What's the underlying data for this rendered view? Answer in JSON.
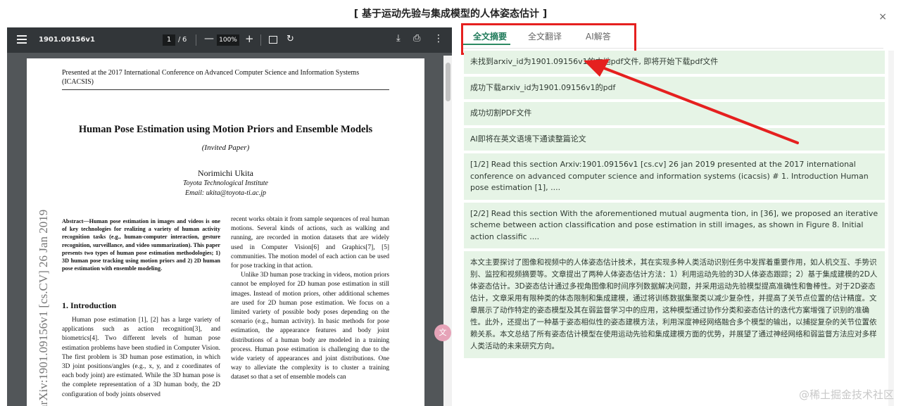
{
  "modal": {
    "title": "[ 基于运动先验与集成模型的人体姿态估计 ]",
    "close_icon": "×"
  },
  "pdf": {
    "toolbar": {
      "filename": "1901.09156v1",
      "page": "1",
      "slash": "/",
      "total": "6",
      "zoom": "100%",
      "minus": "—",
      "plus": "+",
      "rotate": "↻",
      "download": "⤓",
      "print": "⎙",
      "more": "⋮"
    },
    "page": {
      "header": "Presented at the 2017 International Conference on Advanced Computer Science and Information Systems (ICACSIS)",
      "title": "Human Pose Estimation using Motion Priors and Ensemble Models",
      "invited": "(Invited Paper)",
      "author": "Norimichi Ukita",
      "institution": "Toyota Technological Institute",
      "email": "Email: ukita@toyota-ti.ac.jp",
      "arxiv_stamp": "arXiv:1901.09156v1  [cs.CV]  26 Jan 2019",
      "abstract": "Abstract—Human pose estimation in images and videos is one of key technologies for realizing a variety of human activity recognition tasks (e.g., human-computer interaction, gesture recognition, surveillance, and video summarization). This paper presents two types of human pose estimation methodologies; 1) 3D human pose tracking using motion priors and 2) 2D human pose estimation with ensemble modeling.",
      "intro_heading": "1.  Introduction",
      "intro_body": "Human pose estimation [1], [2] has a large variety of applications such as action recognition[3], and biometrics[4]. Two different levels of human pose estimation problems have been studied in Computer Vision. The first problem is 3D human pose estimation, in which 3D joint positions/angles (e.g., x, y, and z coordinates of each body joint) are estimated. While the 3D human pose is the complete representation of a 3D human body, the 2D configuration of body joints observed",
      "right_p1": "recent works obtain it from sample sequences of real human motions. Several kinds of actions, such as walking and running, are recorded in motion datasets that are widely used in Computer Vision[6] and Graphics[7], [5] communities. The motion model of each action can be used for pose tracking in that action.",
      "right_p2": "Unlike 3D human pose tracking in videos, motion priors cannot be employed for 2D human pose estimation in still images. Instead of motion priors, other additional schemes are used for 2D human pose estimation. We focus on a limited variety of possible body poses depending on the scenario (e.g., human activity). In basic methods for pose estimation, the appearance features and body joint distributions of a human body are modeled in a training process. Human pose estimation is challenging due to the wide variety of appearances and joint distributions. One way to alleviate the complexity is to cluster a training dataset so that a set of ensemble models can"
    }
  },
  "tabs": [
    {
      "label": "全文摘要",
      "active": true
    },
    {
      "label": "全文翻译",
      "active": false
    },
    {
      "label": "AI解答",
      "active": false
    }
  ],
  "messages": [
    "未找到arxiv_id为1901.09156v1的本地pdf文件, 即将开始下载pdf文件",
    "成功下载arxiv_id为1901.09156v1的pdf",
    "成功切割PDF文件",
    "AI即将在英文语境下通读整篇论文",
    "[1/2] Read this section Arxiv:1901.09156v1 [cs.cv] 26 jan 2019 presented at the 2017 international conference on advanced computer science and information systems (icacsis) # 1. Introduction Human pose estimation [1], ....",
    "[2/2] Read this section With the aforementioned mutual augmenta tion, in [36], we proposed an iterative scheme between action classiﬁcation and pose estimation in still images, as shown in Figure 8. Initial action classiﬁc ...."
  ],
  "summary": "本文主要探讨了图像和视频中的人体姿态估计技术，其在实现多种人类活动识别任务中发挥着重要作用，如人机交互、手势识别、监控和视频摘要等。文章提出了两种人体姿态估计方法：1）利用运动先验的3D人体姿态跟踪；2）基于集成建模的2D人体姿态估计。3D姿态估计通过多视角图像和时间序列数据解决问题，并采用运动先验模型提高准确性和鲁棒性。对于2D姿态估计，文章采用有限种类的体态限制和集成建模，通过将训练数据集聚类以减少复杂性，并提高了关节点位置的估计精度。文章展示了动作特定的姿态模型及其在弱监督学习中的应用，这种模型通过协作分类和姿态估计的迭代方案增强了识别的准确性。此外，还提出了一种基于姿态相似性的姿态建模方法，利用深度神经网络融合多个模型的输出，以捕捉复杂的关节位置依赖关系。本文总结了所有姿态估计模型在使用运动先验和集成建模方面的优势，并展望了通过神经网络和弱监督方法应对多样人类活动的未来研究方向。",
  "translate_fab": "文",
  "watermark": "@稀土掘金技术社区",
  "colors": {
    "annotation": "#e5201f",
    "active_tab": "#1f7a5a",
    "message_bg": "#e6f4e6"
  }
}
